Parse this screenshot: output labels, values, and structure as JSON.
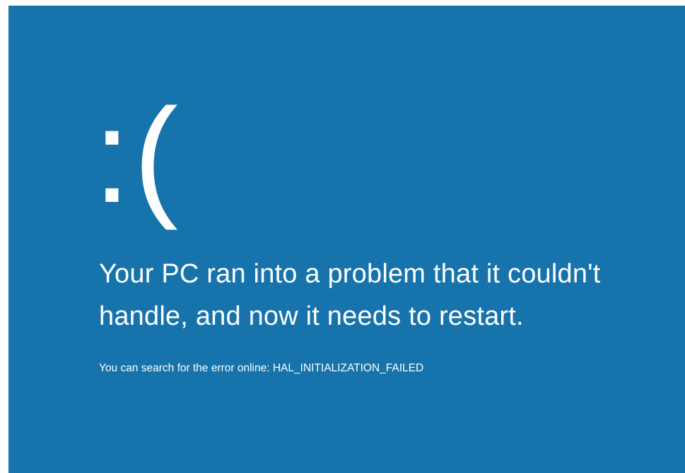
{
  "bsod": {
    "face": ":(",
    "message": "Your PC ran into a problem that it couldn't handle, and now it needs to restart.",
    "error_prefix": "You can search for the error online:",
    "stop_code": "HAL_INITIALIZATION_FAILED"
  },
  "colors": {
    "background": "#1673ac",
    "text": "#ffffff"
  }
}
